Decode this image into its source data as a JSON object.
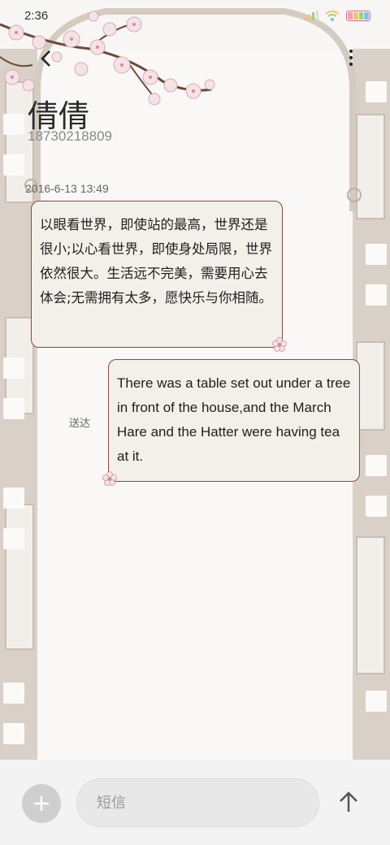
{
  "status_bar": {
    "time": "2:36",
    "signal_icon": "signal-bars-icon",
    "wifi_icon": "wifi-icon",
    "battery_icon": "battery-icon",
    "battery_colors": [
      "#f2a2b3",
      "#f5c46b",
      "#9ad47a",
      "#7cc4e6"
    ]
  },
  "header": {
    "back_icon": "chevron-left-icon",
    "menu_icon": "more-vertical-icon",
    "contact_name": "倩倩",
    "contact_number": "18730218809"
  },
  "conversation": {
    "timestamp": "2016-6-13 13:49",
    "messages": [
      {
        "direction": "incoming",
        "text": "以眼看世界，即使站的最高，世界还是很小;以心看世界，即使身处局限，世界依然很大。生活远不完美，需要用心去体会;无需拥有太多，愿快乐与你相随。"
      },
      {
        "direction": "outgoing",
        "text": "There was a table set out under a tree in front of the house,and the March Hare and the Hatter were having tea at it.",
        "status": "送达"
      }
    ]
  },
  "composer": {
    "add_icon": "plus-icon",
    "placeholder": "短信",
    "value": "",
    "send_icon": "arrow-up-icon"
  },
  "theme": {
    "bubble_border": "#8a4a40",
    "bubble_fill": "#f3efe9",
    "film_strip": "#d9d1c8"
  }
}
